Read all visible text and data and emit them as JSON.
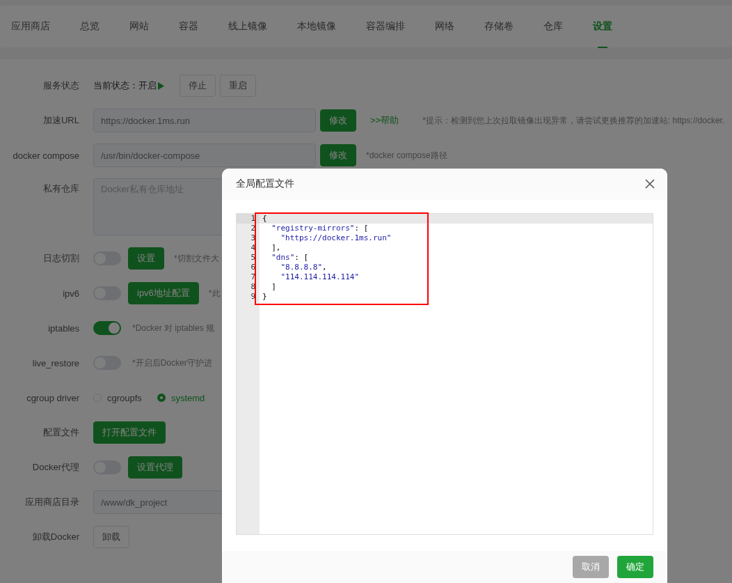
{
  "tabs": [
    {
      "label": "应用商店",
      "selected": false
    },
    {
      "label": "总览",
      "selected": false
    },
    {
      "label": "网站",
      "selected": false
    },
    {
      "label": "容器",
      "selected": false
    },
    {
      "label": "线上镜像",
      "selected": false
    },
    {
      "label": "本地镜像",
      "selected": false
    },
    {
      "label": "容器编排",
      "selected": false
    },
    {
      "label": "网络",
      "selected": false
    },
    {
      "label": "存储卷",
      "selected": false
    },
    {
      "label": "仓库",
      "selected": false
    },
    {
      "label": "设置",
      "selected": true
    }
  ],
  "settings": [
    {
      "label": "服务状态",
      "controls": [
        {
          "kind": "status",
          "text": "当前状态：开启",
          "running": true
        },
        {
          "kind": "button",
          "text": "停止",
          "primary": false
        },
        {
          "kind": "button",
          "text": "重启",
          "primary": false
        }
      ]
    },
    {
      "label": "加速URL",
      "controls": [
        {
          "kind": "input",
          "value": "https://docker.1ms.run"
        },
        {
          "kind": "button",
          "text": "修改",
          "primary": true
        },
        {
          "kind": "link",
          "text": ">>帮助"
        },
        {
          "kind": "hint",
          "text": "*提示：检测到您上次拉取镜像出现异常，请尝试更换推荐的加速站: https://docker."
        }
      ]
    },
    {
      "label": "docker compose",
      "controls": [
        {
          "kind": "input",
          "value": "/usr/bin/docker-compose"
        },
        {
          "kind": "button",
          "text": "修改",
          "primary": true
        },
        {
          "kind": "hint",
          "text": "*docker compose路径"
        }
      ]
    },
    {
      "label": "私有仓库",
      "controls": [
        {
          "kind": "textarea",
          "placeholder": "Docker私有仓库地址"
        }
      ]
    },
    {
      "label": "日志切割",
      "controls": [
        {
          "kind": "switch",
          "on": false
        },
        {
          "kind": "button",
          "text": "设置",
          "primary": true
        },
        {
          "kind": "hint",
          "text": "*切割文件大"
        }
      ]
    },
    {
      "label": "ipv6",
      "controls": [
        {
          "kind": "switch",
          "on": false
        },
        {
          "kind": "button",
          "text": "ipv6地址配置",
          "primary": true
        },
        {
          "kind": "hint",
          "text": "*此"
        }
      ]
    },
    {
      "label": "iptables",
      "controls": [
        {
          "kind": "switch",
          "on": true
        },
        {
          "kind": "hint",
          "text": "*Docker 对 iptables 规"
        }
      ]
    },
    {
      "label": "live_restore",
      "controls": [
        {
          "kind": "switch",
          "on": false
        },
        {
          "kind": "hint",
          "text": "*开启后Docker守护进"
        }
      ]
    },
    {
      "label": "cgroup driver",
      "controls": [
        {
          "kind": "radio",
          "options": [
            {
              "text": "cgroupfs",
              "selected": false
            },
            {
              "text": "systemd",
              "selected": true
            }
          ]
        }
      ]
    },
    {
      "label": "配置文件",
      "controls": [
        {
          "kind": "button",
          "text": "打开配置文件",
          "primary": true
        }
      ]
    },
    {
      "label": "Docker代理",
      "controls": [
        {
          "kind": "switch",
          "on": false
        },
        {
          "kind": "button",
          "text": "设置代理",
          "primary": true
        }
      ]
    },
    {
      "label": "应用商店目录",
      "controls": [
        {
          "kind": "input",
          "value": "/www/dk_project"
        }
      ]
    },
    {
      "label": "卸载Docker",
      "controls": [
        {
          "kind": "button",
          "text": "卸载",
          "primary": false
        }
      ]
    }
  ],
  "dialog": {
    "title": "全局配置文件",
    "editor": {
      "lines": [
        {
          "number": "1",
          "active": true,
          "tokens": [
            {
              "kind": "punct",
              "text": "{"
            }
          ]
        },
        {
          "number": "2",
          "active": false,
          "tokens": [
            {
              "kind": "string",
              "text": "  \"registry-mirrors\""
            },
            {
              "kind": "punct",
              "text": ": ["
            }
          ]
        },
        {
          "number": "3",
          "active": false,
          "tokens": [
            {
              "kind": "string",
              "text": "    \"https://docker.1ms.run\""
            }
          ]
        },
        {
          "number": "4",
          "active": false,
          "tokens": [
            {
              "kind": "punct",
              "text": "  ],"
            }
          ]
        },
        {
          "number": "5",
          "active": false,
          "tokens": [
            {
              "kind": "string",
              "text": "  \"dns\""
            },
            {
              "kind": "punct",
              "text": ": ["
            }
          ]
        },
        {
          "number": "6",
          "active": false,
          "tokens": [
            {
              "kind": "string",
              "text": "    \"8.8.8.8\""
            },
            {
              "kind": "punct",
              "text": ","
            }
          ]
        },
        {
          "number": "7",
          "active": false,
          "tokens": [
            {
              "kind": "string",
              "text": "    \"114.114.114.114\""
            }
          ]
        },
        {
          "number": "8",
          "active": false,
          "tokens": [
            {
              "kind": "punct",
              "text": "  ]"
            }
          ]
        },
        {
          "number": "9",
          "active": false,
          "tokens": [
            {
              "kind": "punct",
              "text": "}"
            }
          ]
        }
      ]
    },
    "buttons": [
      {
        "kind": "cancel",
        "text": "取消"
      },
      {
        "kind": "confirm",
        "text": "确定"
      }
    ]
  }
}
